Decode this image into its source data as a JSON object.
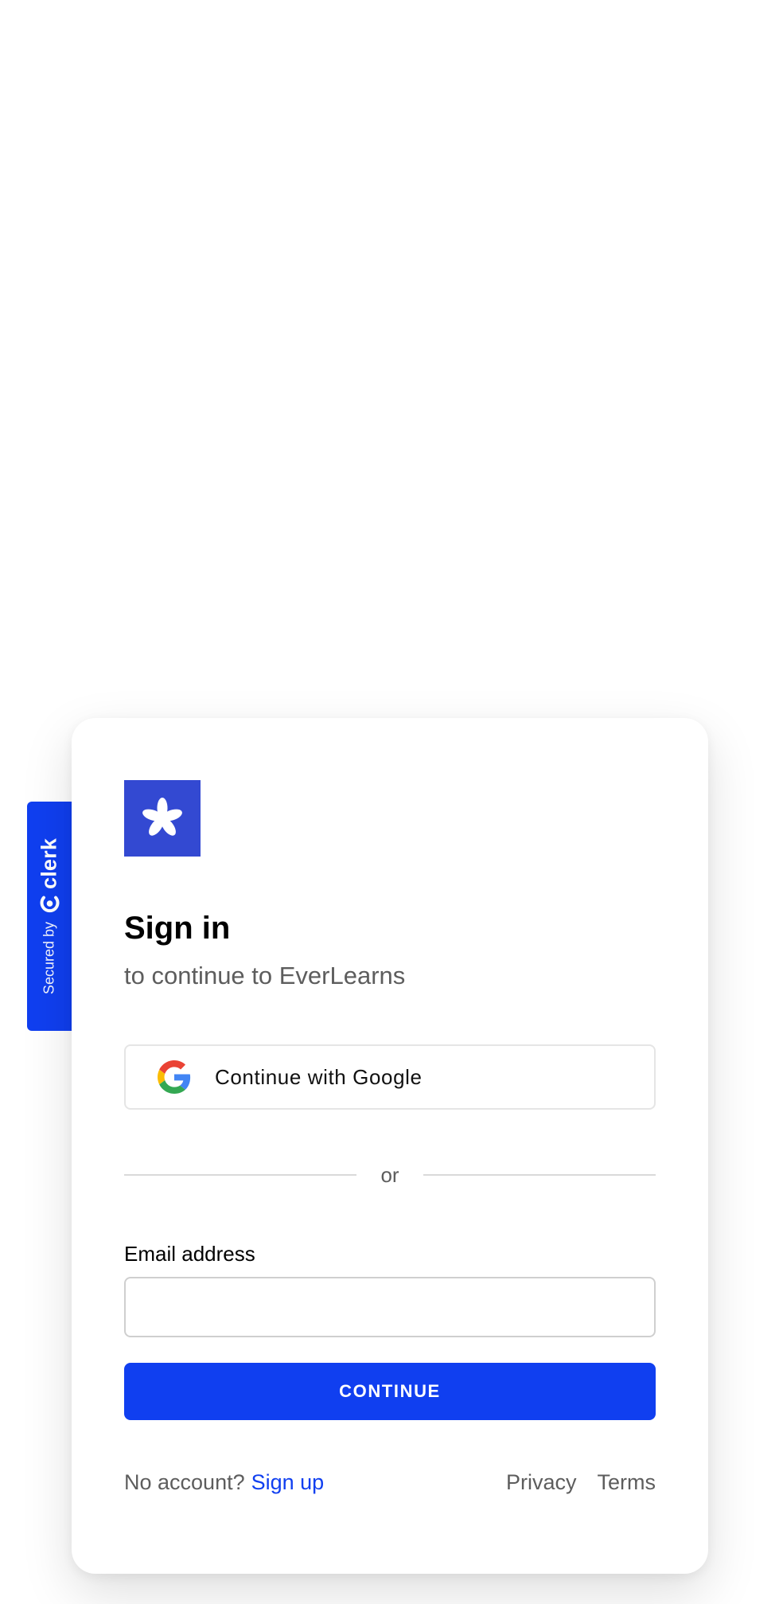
{
  "badge": {
    "secured_by": "Secured by",
    "brand": "clerk"
  },
  "card": {
    "title": "Sign in",
    "subtitle": "to continue to EverLearns",
    "google_button_label": "Continue with Google",
    "divider_text": "or",
    "email_label": "Email address",
    "email_value": "",
    "email_placeholder": "",
    "continue_label": "CONTINUE",
    "footer": {
      "no_account_text": "No account?",
      "signup_label": "Sign up",
      "privacy_label": "Privacy",
      "terms_label": "Terms"
    }
  },
  "icons": {
    "app_logo": "asterisk-icon",
    "google": "google-g-icon",
    "clerk": "clerk-logo-icon"
  },
  "colors": {
    "accent": "#103ff0",
    "app_logo_bg": "#3349d2",
    "text_muted": "#5d5d5d"
  }
}
